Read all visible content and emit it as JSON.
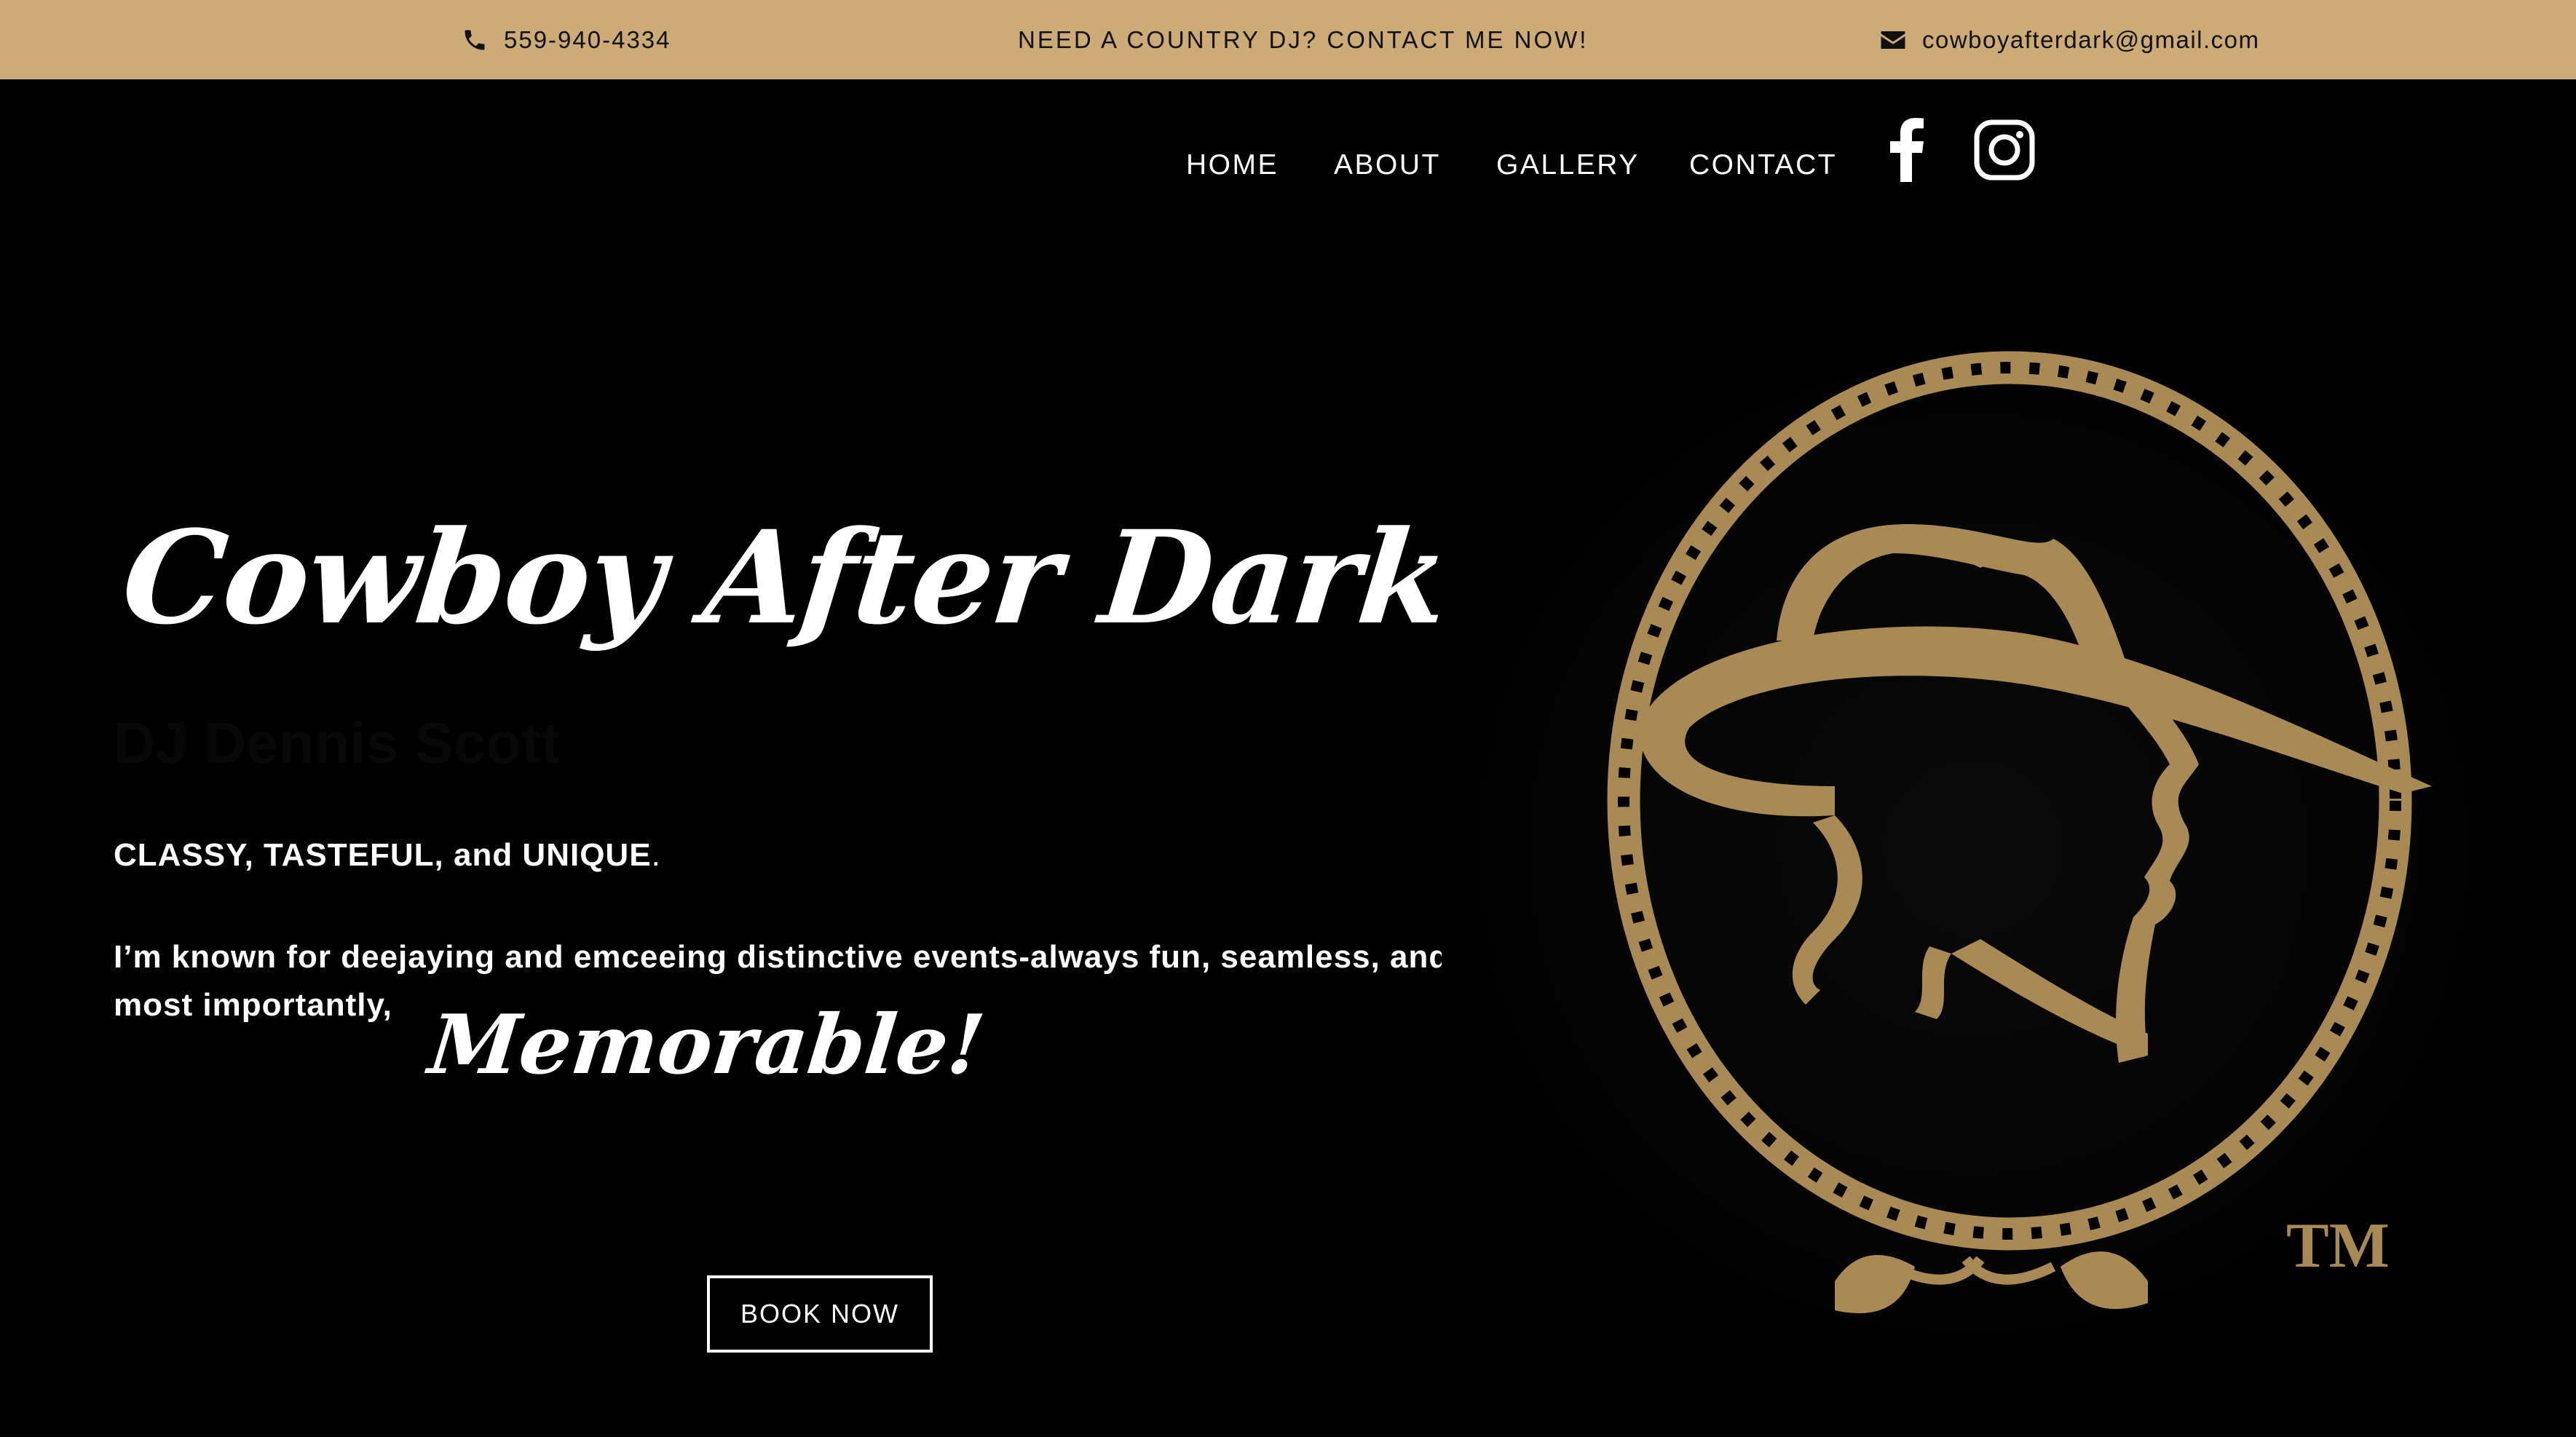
{
  "colors": {
    "accent": "#cdab76",
    "logo_gold": "#a98a55",
    "background": "#000000"
  },
  "topbar": {
    "phone": "559-940-4334",
    "promo": "NEED A COUNTRY DJ? CONTACT ME NOW!",
    "email": "cowboyafterdark@gmail.com",
    "icons": [
      "phone-icon",
      "envelope-icon"
    ]
  },
  "nav": {
    "items": [
      {
        "label": "HOME"
      },
      {
        "label": "ABOUT"
      },
      {
        "label": "GALLERY"
      },
      {
        "label": "CONTACT"
      }
    ],
    "social": [
      "facebook-icon",
      "instagram-icon"
    ]
  },
  "hero": {
    "title": "Cowboy After Dark",
    "subtitle": "DJ Dennis Scott",
    "tagline_caps": "CLASSY, TASTEFUL, and UNIQUE",
    "tagline_end": ".",
    "body": "I’m known for deejaying and emceeing distinctive events-always fun, seamless, and most importantly,",
    "emphasis": "Memorable!",
    "cta": "BOOK NOW"
  },
  "logo": {
    "mark": "TM",
    "icon": "cowboy-rope-logo"
  }
}
